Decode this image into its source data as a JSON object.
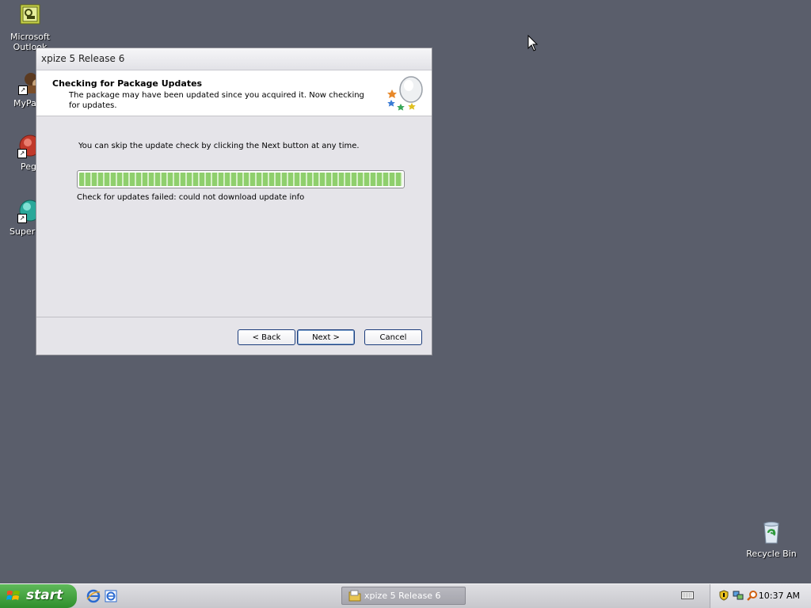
{
  "desktop": {
    "icons": [
      {
        "label": "Microsoft Outlook",
        "icon": "outlook-icon"
      },
      {
        "label": "MyPa",
        "icon": "mypa-icon"
      },
      {
        "label": "Peg",
        "icon": "peg-icon"
      },
      {
        "label": "Superr",
        "icon": "superr-icon"
      },
      {
        "label": "Recycle Bin",
        "icon": "recycle-bin-icon"
      }
    ]
  },
  "dialog": {
    "title": "xpize 5 Release 6",
    "header_title": "Checking for Package Updates",
    "header_subtitle": "The package may have been updated since you acquired it. Now checking for updates.",
    "header_icon": "package-stars-icon",
    "body_text": "You can skip the update check by clicking the Next button at any time.",
    "progress": 1.0,
    "status_text": "Check for updates failed: could not download update info",
    "buttons": {
      "back": "< Back",
      "next": "Next >",
      "cancel": "Cancel"
    }
  },
  "taskbar": {
    "start_label": "start",
    "quick_launch": [
      "internet-explorer-icon",
      "ie-edit-icon"
    ],
    "task_item_label": "xpize 5 Release 6",
    "clock": "10:37 AM",
    "tray_icons": [
      "security-shield-icon",
      "network-icon",
      "search-icon"
    ]
  },
  "colors": {
    "desktop_bg": "#5a5e6b",
    "progress_green": "#8fcf6d"
  }
}
